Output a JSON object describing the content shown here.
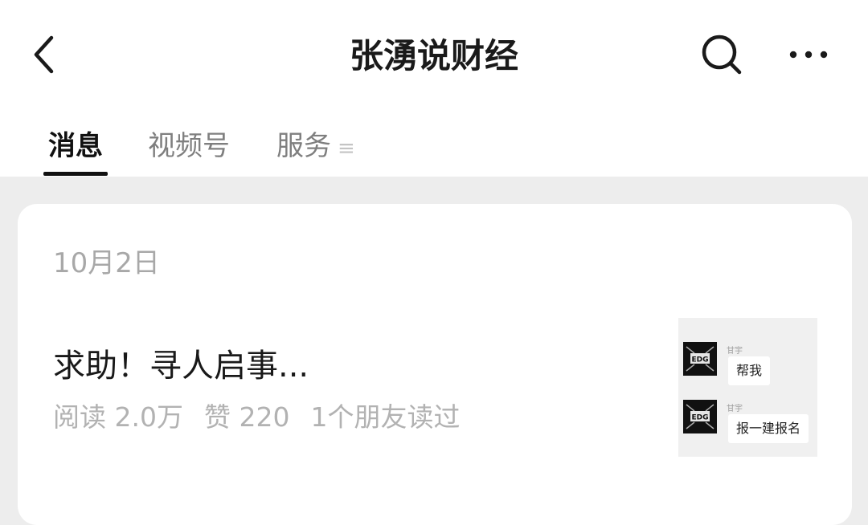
{
  "header": {
    "title": "张湧说财经"
  },
  "icons": {
    "back": "chevron-left-icon",
    "search": "search-icon",
    "more": "more-horizontal-icon"
  },
  "tabs": [
    {
      "label": "消息",
      "active": true
    },
    {
      "label": "视频号",
      "active": false
    },
    {
      "label": "服务",
      "active": false,
      "menu_icon": "≡"
    }
  ],
  "post": {
    "date": "10月2日",
    "title": "求助！寻人启事...",
    "reads": "阅读 2.0万",
    "likes": "赞 220",
    "friends_read": "1个朋友读过"
  },
  "thumbnail": {
    "messages": [
      {
        "sender": "甘宇",
        "avatar_text": "EDG",
        "text": "帮我"
      },
      {
        "sender": "甘宇",
        "avatar_text": "EDG",
        "text": "报一建报名"
      }
    ]
  },
  "colors": {
    "background": "#ededed",
    "card": "#ffffff",
    "title_text": "#1a1a1a",
    "muted_text": "#b2b2b2",
    "active_tab_indicator": "#111111"
  }
}
